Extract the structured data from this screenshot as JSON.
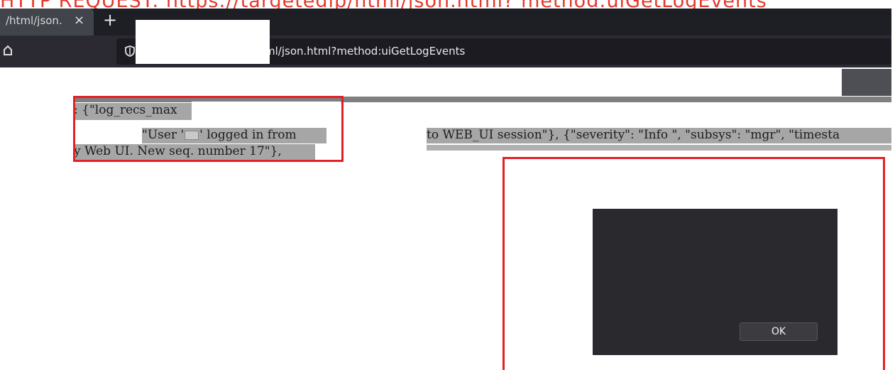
{
  "caption": "HTTP REQUEST: https://targetedip/html/json.html? method:uiGetLogEvents",
  "browser": {
    "tab_title": "/html/json.",
    "tab_close": "×",
    "new_tab": "+",
    "url_partial": "ml/json.html?method:uiGetLogEvents"
  },
  "content": {
    "line1": ": {\"log_recs_max",
    "line2a": "\"User '",
    "line2b": "' logged in from",
    "line3": "y Web UI. New seq. number 17\"},",
    "line2_right": "to WEB_UI session\"}, {\"severity\": \"Info \", \"subsys\": \"mgr\", \"timesta"
  },
  "dialog": {
    "ok_label": "OK"
  },
  "colors": {
    "annotation": "#e22126",
    "caption": "#e6382c",
    "highlight": "#a6a6a6"
  }
}
